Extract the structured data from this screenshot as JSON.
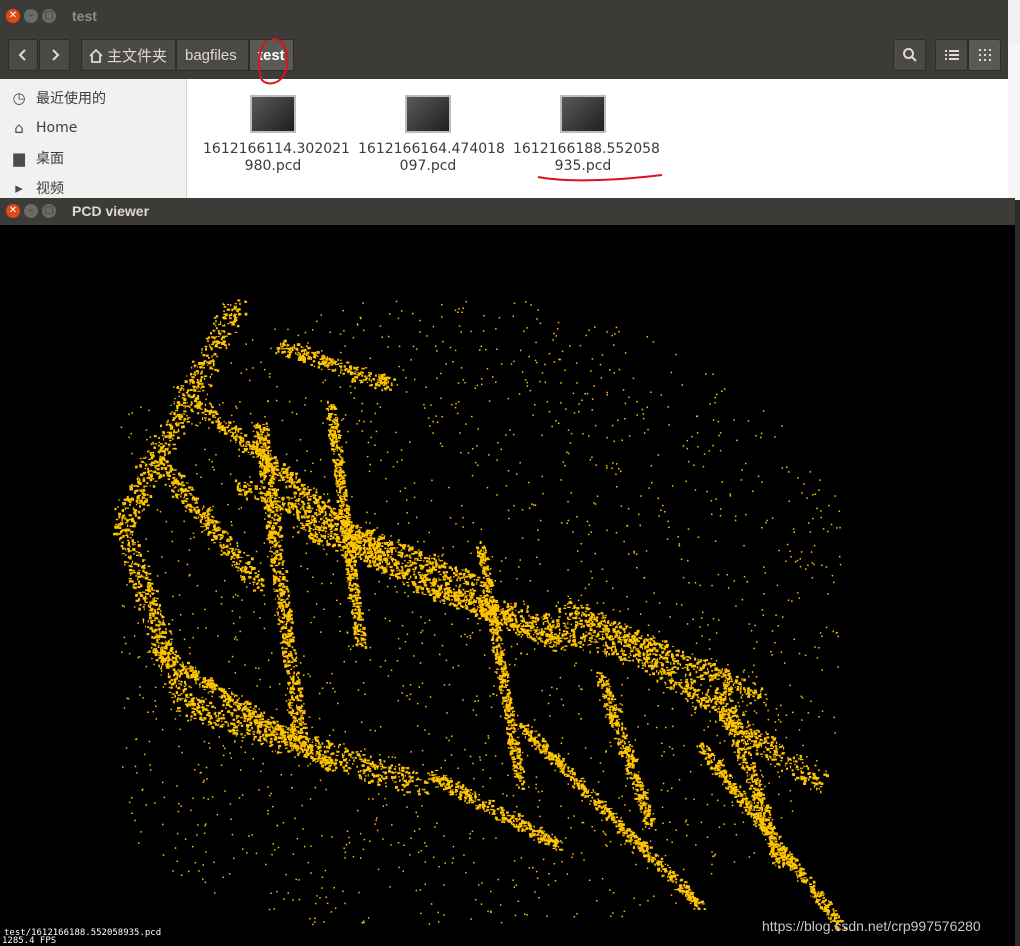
{
  "file_manager": {
    "title": "test",
    "toolbar": {
      "back_icon": "chevron-left-icon",
      "forward_icon": "chevron-right-icon",
      "breadcrumbs": [
        {
          "label": "主文件夹",
          "icon": "home-icon"
        },
        {
          "label": "bagfiles"
        },
        {
          "label": "test",
          "active": true
        }
      ],
      "search_icon": "search-icon",
      "list_view_icon": "list-view-icon",
      "grid_view_icon": "grid-view-icon"
    },
    "sidebar": {
      "items": [
        {
          "label": "最近使用的",
          "icon": "clock-icon"
        },
        {
          "label": "Home",
          "icon": "home-icon"
        },
        {
          "label": "桌面",
          "icon": "folder-icon"
        },
        {
          "label": "视频",
          "icon": "video-icon"
        }
      ]
    },
    "files": [
      {
        "line1": "1612166114.302021",
        "line2": "980.pcd"
      },
      {
        "line1": "1612166164.474018",
        "line2": "097.pcd"
      },
      {
        "line1": "1612166188.552058",
        "line2": "935.pcd",
        "annotated": true
      }
    ]
  },
  "pcd_viewer": {
    "title": "PCD viewer",
    "file_label": "test/1612166188.552058935.pcd",
    "fps_label": "1285.4 FPS",
    "point_color": "#ffc400"
  },
  "watermark": "https://blog.csdn.net/crp997576280",
  "annotation_color": "#e0101a"
}
